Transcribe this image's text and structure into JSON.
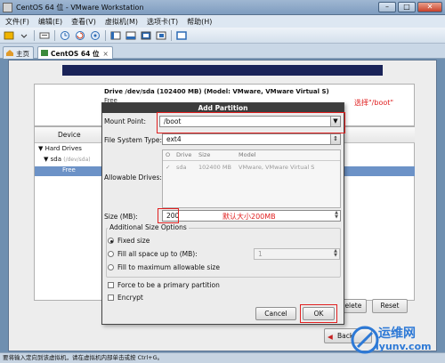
{
  "window": {
    "title": "CentOS 64 位 - VMware Workstation",
    "buttons": [
      "–",
      "□",
      "✕"
    ]
  },
  "menubar": [
    "文件(F)",
    "编辑(E)",
    "查看(V)",
    "虚拟机(M)",
    "选项卡(T)",
    "帮助(H)"
  ],
  "tabs": [
    {
      "label": "主页",
      "active": false
    },
    {
      "label": "CentOS 64 位",
      "active": true,
      "close": "×"
    }
  ],
  "drive_summary": {
    "title": "Drive /dev/sda (102400 MB) (Model: VMware, VMware Virtual S)",
    "free_label": "Free"
  },
  "annotations": {
    "boot": "选择\"/boot\"",
    "size": "默认大小200MB"
  },
  "device_panel": {
    "header": "Device",
    "tree": [
      {
        "label": "Hard Drives",
        "expander": "▼"
      },
      {
        "label": "sda",
        "expander": "▼",
        "sub": "(/dev/sda)"
      },
      {
        "label": "Free",
        "selected": true
      }
    ],
    "buttons": {
      "delete": "Delete",
      "reset": "Reset"
    }
  },
  "nav": {
    "back": "Back"
  },
  "dialog": {
    "title": "Add Partition",
    "mount_point_label": "Mount Point:",
    "mount_point_value": "/boot",
    "fs_type_label": "File System Type:",
    "fs_type_value": "ext4",
    "allowable_drives_label": "Allowable Drives:",
    "drives_columns": [
      "O",
      "Drive",
      "Size",
      "Model"
    ],
    "drives_rows": [
      {
        "check": "✓",
        "drive": "sda",
        "size": "102400 MB",
        "model": "VMware, VMware Virtual S"
      }
    ],
    "size_label": "Size (MB):",
    "size_value": "200",
    "additional_size_label": "Additional Size Options",
    "options": [
      {
        "label": "Fixed size",
        "selected": true
      },
      {
        "label": "Fill all space up to (MB):",
        "selected": false
      },
      {
        "label": "Fill to maximum allowable size",
        "selected": false
      }
    ],
    "fill_up_to_value": "1",
    "primary_label": "Force to be a primary partition",
    "encrypt_label": "Encrypt",
    "cancel_label": "Cancel",
    "ok_label": "OK"
  },
  "statusbar": "要将输入定向到该虚拟机，请在虚拟机内部单击或按 Ctrl+G。",
  "watermark": {
    "text": "运维网",
    "url": "iyunv.com"
  },
  "colors": {
    "selection": "#6c92c7",
    "annotation": "#e02020",
    "dialog_title_bg": "#3c3c3c"
  }
}
